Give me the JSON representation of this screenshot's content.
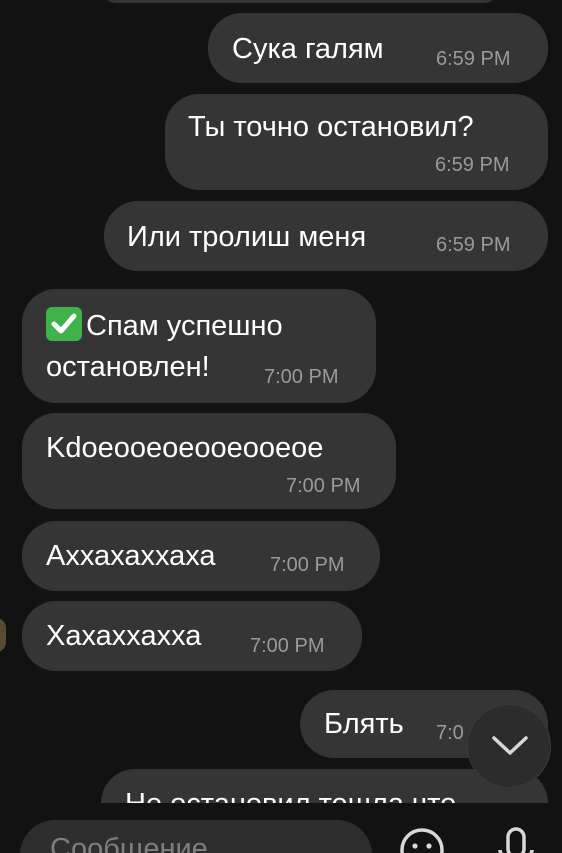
{
  "messages": [
    {
      "text": "Сука галям",
      "time": "6:59 PM",
      "direction": "out"
    },
    {
      "text": "Ты точно остановил?",
      "time": "6:59 PM",
      "direction": "out"
    },
    {
      "text": "Или тролиш меня",
      "time": "6:59 PM",
      "direction": "out"
    },
    {
      "line1": "Спам успешно",
      "line2": "остановлен!",
      "time": "7:00 PM",
      "direction": "in",
      "icon": "check-mark-button-emoji"
    },
    {
      "text": "Kdoeooeoeooeooeoe",
      "time": "7:00 PM",
      "direction": "in"
    },
    {
      "text": "Аххахаххаха",
      "time": "7:00 PM",
      "direction": "in"
    },
    {
      "text": "Хахаххахха",
      "time": "7:00 PM",
      "direction": "in"
    },
    {
      "text": "Блять",
      "time": "7:0",
      "direction": "out"
    },
    {
      "text": "Не остановил тешла что",
      "direction": "out"
    }
  ],
  "composer": {
    "placeholder": "Сообщение"
  },
  "icons": {
    "scroll_down": "chevron-down-icon",
    "emoji": "emoji-icon",
    "mic": "microphone-icon"
  },
  "colors": {
    "background": "#121212",
    "bubble": "#353535",
    "text": "#ffffff",
    "timestamp": "#9a9a9a",
    "check_emoji": "#3fb24a"
  }
}
